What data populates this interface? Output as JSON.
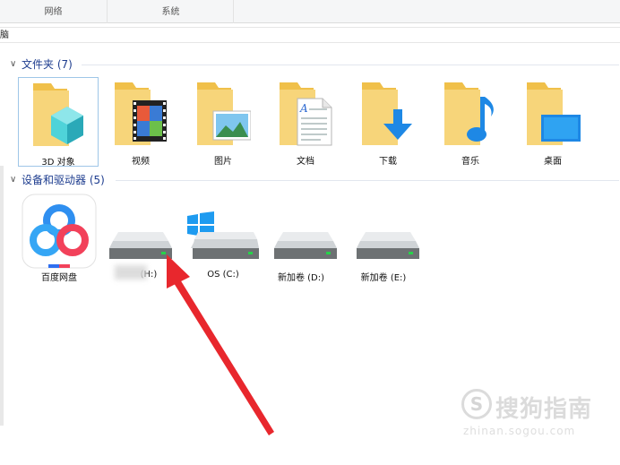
{
  "ribbon": {
    "tabs": [
      "网络",
      "系统"
    ]
  },
  "address": {
    "path": "电脑"
  },
  "groups": {
    "folders": {
      "title": "文件夹 (7)"
    },
    "devices": {
      "title": "设备和驱动器 (5)"
    }
  },
  "folders": [
    {
      "label": "3D 对象",
      "icon": "3d-objects-icon"
    },
    {
      "label": "视频",
      "icon": "videos-icon"
    },
    {
      "label": "图片",
      "icon": "pictures-icon"
    },
    {
      "label": "文档",
      "icon": "documents-icon"
    },
    {
      "label": "下载",
      "icon": "downloads-icon"
    },
    {
      "label": "音乐",
      "icon": "music-icon"
    },
    {
      "label": "桌面",
      "icon": "desktop-icon"
    }
  ],
  "devices": [
    {
      "label": "百度网盘",
      "icon": "baidu-netdisk-icon"
    },
    {
      "label": "(H:)",
      "icon": "drive-icon"
    },
    {
      "label": "OS (C:)",
      "icon": "windows-drive-icon"
    },
    {
      "label": "新加卷 (D:)",
      "icon": "drive-icon"
    },
    {
      "label": "新加卷 (E:)",
      "icon": "drive-icon"
    }
  ],
  "watermark": {
    "text": "搜狗指南",
    "url": "zhinan.sogou.com",
    "logo": "S"
  },
  "colors": {
    "folder": "#f7d57a",
    "header": "#1e3d8f",
    "arrow": "#e8272d",
    "accent": "#1e88e5"
  }
}
